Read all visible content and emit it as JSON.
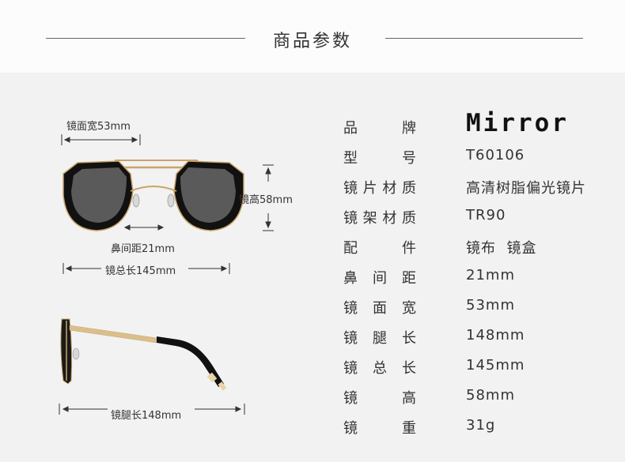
{
  "header": {
    "title": "商品参数"
  },
  "dimensions": {
    "lens_width": "镜面宽53mm",
    "lens_height": "镜高58mm",
    "bridge": "鼻间距21mm",
    "total_length": "镜总长145mm",
    "temple_length": "镜腿长148mm"
  },
  "specs": [
    {
      "key": "品牌",
      "value": "Mirror"
    },
    {
      "key": "型号",
      "value": "T60106"
    },
    {
      "key": "镜片材质",
      "value": "高清树脂偏光镜片"
    },
    {
      "key": "镜架材质",
      "value": "TR90"
    },
    {
      "key": "配件",
      "value": "镜布  镜盒"
    },
    {
      "key": "鼻间距",
      "value": "21mm"
    },
    {
      "key": "镜面宽",
      "value": "53mm"
    },
    {
      "key": "镜腿长",
      "value": "148mm"
    },
    {
      "key": "镜总长",
      "value": "145mm"
    },
    {
      "key": "镜高",
      "value": "58mm"
    },
    {
      "key": "镜重",
      "value": "31g"
    }
  ],
  "colors": {
    "frame_gold": "#c9a46a",
    "frame_black": "#111111",
    "lens_grey": "#5a5a5a",
    "background": "#f2f2f2"
  }
}
